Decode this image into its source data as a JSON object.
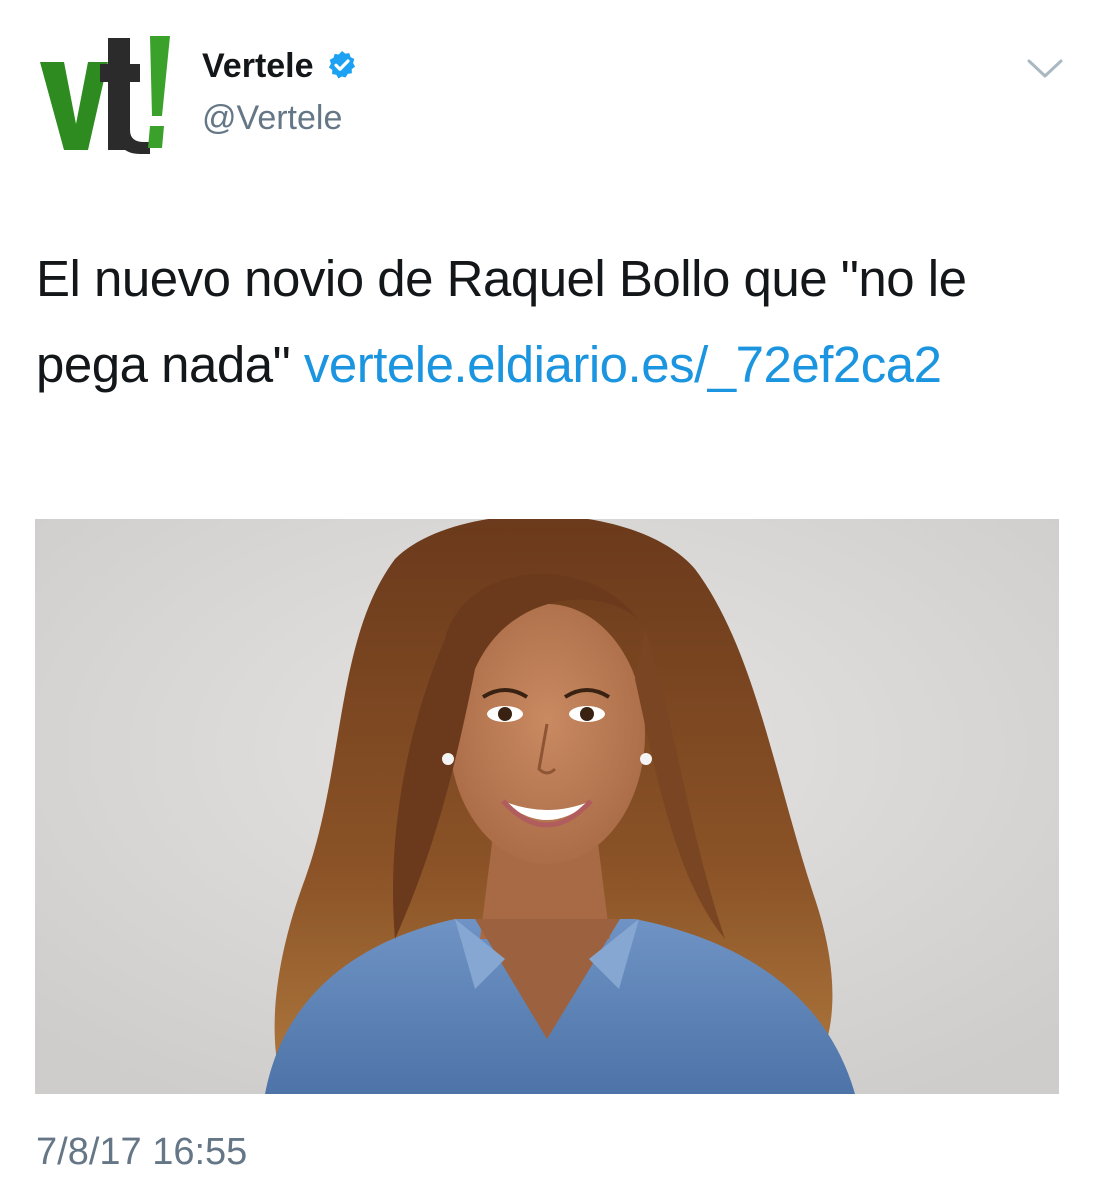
{
  "tweet": {
    "avatar_text": "vt!",
    "display_name": "Vertele",
    "handle": "@Vertele",
    "text_plain": "El nuevo novio de Raquel Bollo que \"no le pega nada\" ",
    "link_text": "vertele.eldiario.es/_72ef2ca2",
    "timestamp": "7/8/17 16:55",
    "link_color": "#1b95e0",
    "verified_color": "#1da1f2",
    "icons": {
      "verified": "verified-badge-icon",
      "more": "chevron-down-icon"
    }
  }
}
